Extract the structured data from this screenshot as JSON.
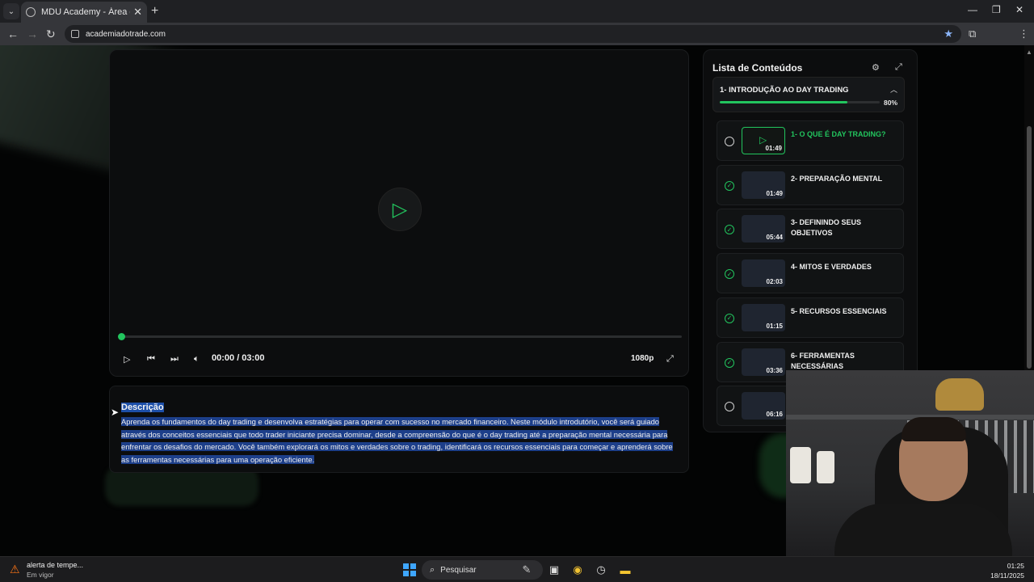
{
  "browser": {
    "tab_title": "MDU Academy - Área de Memi",
    "url": "academiadotrade.com",
    "new_tab": "+",
    "close_tab": "✕"
  },
  "player": {
    "time": "00:00 / 03:00",
    "quality": "1080p",
    "progress": 0.0
  },
  "description": {
    "title": "Descrição",
    "text": "Aprenda os fundamentos do day trading e desenvolva estratégias para operar com sucesso no mercado financeiro. Neste módulo introdutório, você será guiado através dos conceitos essenciais que todo trader iniciante precisa dominar, desde a compreensão do que é o day trading até a preparação mental necessária para enfrentar os desafios do mercado. Você também explorará os mitos e verdades sobre o trading, identificará os recursos essenciais para começar e aprenderá sobre as ferramentas necessárias para uma operação eficiente."
  },
  "sidebar": {
    "title": "Lista de Conteúdos",
    "module": {
      "title": "1- INTRODUÇÃO AO DAY TRADING",
      "progress_label": "80%",
      "progress": 0.8
    },
    "lessons": [
      {
        "title": "1- O QUE É DAY TRADING?",
        "duration": "01:49",
        "done": false,
        "active": true
      },
      {
        "title": "2- PREPARAÇÃO MENTAL",
        "duration": "01:49",
        "done": true,
        "active": false
      },
      {
        "title": "3- DEFININDO SEUS OBJETIVOS",
        "duration": "05:44",
        "done": true,
        "active": false
      },
      {
        "title": "4- MITOS E VERDADES",
        "duration": "02:03",
        "done": true,
        "active": false
      },
      {
        "title": "5- RECURSOS ESSENCIAIS",
        "duration": "01:15",
        "done": true,
        "active": false
      },
      {
        "title": "6- FERRAMENTAS NECESSÁRIAS",
        "duration": "03:36",
        "done": true,
        "active": false
      },
      {
        "title": "",
        "duration": "06:16",
        "done": false,
        "active": false
      }
    ]
  },
  "taskbar": {
    "alert_title": "alerta de tempe...",
    "alert_sub": "Em vigor",
    "search_placeholder": "Pesquisar",
    "time": "01:25",
    "date": "18/11/2025"
  },
  "colors": {
    "accent": "#22c55e",
    "selection": "#1d3f8a"
  }
}
